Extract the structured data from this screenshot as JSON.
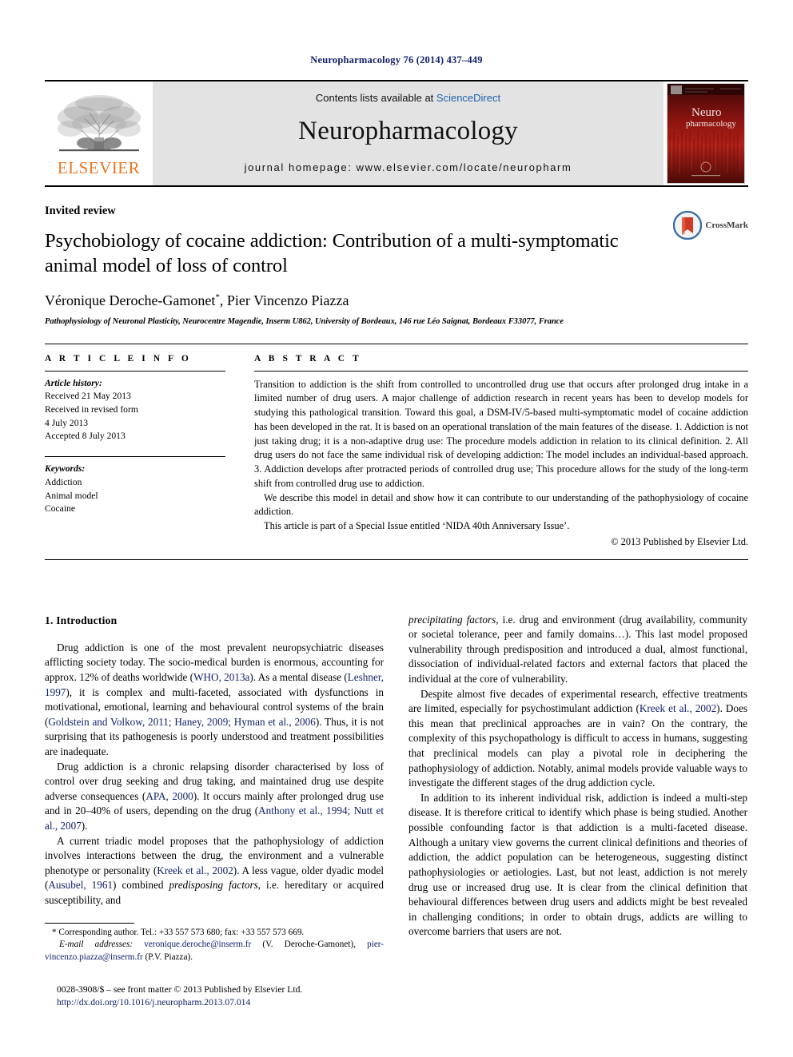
{
  "running_head": "Neuropharmacology 76 (2014) 437–449",
  "masthead": {
    "publisher_name": "ELSEVIER",
    "contents_prefix": "Contents lists available at ",
    "sciencedirect": "ScienceDirect",
    "journal_name": "Neuropharmacology",
    "homepage": "journal homepage: www.elsevier.com/locate/neuropharm",
    "cover": {
      "line1": "Neuro",
      "line2": "pharmacology",
      "accent_color": "#8e1410"
    },
    "link_color": "#2161b0"
  },
  "article": {
    "type": "Invited review",
    "title": "Psychobiology of cocaine addiction: Contribution of a multi-symptomatic animal model of loss of control",
    "authors": "Véronique Deroche-Gamonet*, Pier Vincenzo Piazza",
    "affiliation": "Pathophysiology of Neuronal Plasticity, Neurocentre Magendie, Inserm U862, University of Bordeaux, 146 rue Léo Saignat, Bordeaux F33077, France",
    "crossmark_label": "CrossMark"
  },
  "info": {
    "heading": "A R T I C L E  I N F O",
    "history_label": "Article history:",
    "history": [
      "Received 21 May 2013",
      "Received in revised form",
      "4 July 2013",
      "Accepted 8 July 2013"
    ],
    "keywords_label": "Keywords:",
    "keywords": [
      "Addiction",
      "Animal model",
      "Cocaine"
    ]
  },
  "abstract": {
    "heading": "A B S T R A C T",
    "paragraphs": [
      "Transition to addiction is the shift from controlled to uncontrolled drug use that occurs after prolonged drug intake in a limited number of drug users. A major challenge of addiction research in recent years has been to develop models for studying this pathological transition. Toward this goal, a DSM-IV/5-based multi-symptomatic model of cocaine addiction has been developed in the rat. It is based on an operational translation of the main features of the disease. 1. Addiction is not just taking drug; it is a non-adaptive drug use: The procedure models addiction in relation to its clinical definition. 2. All drug users do not face the same individual risk of developing addiction: The model includes an individual-based approach. 3. Addiction develops after protracted periods of controlled drug use; This procedure allows for the study of the long-term shift from controlled drug use to addiction.",
      "We describe this model in detail and show how it can contribute to our understanding of the pathophysiology of cocaine addiction.",
      "This article is part of a Special Issue entitled ‘NIDA 40th Anniversary Issue’."
    ],
    "copyright": "© 2013 Published by Elsevier Ltd."
  },
  "body": {
    "section_number_title": "1.  Introduction",
    "left_column": [
      {
        "id": "para-1",
        "indent": true,
        "runs": [
          {
            "t": "Drug addiction is one of the most prevalent neuropsychiatric diseases afflicting society today. The socio-medical burden is enormous, accounting for approx. 12% of deaths worldwide (",
            "s": "normal"
          },
          {
            "t": "WHO, 2013a",
            "s": "cite"
          },
          {
            "t": "). As a mental disease (",
            "s": "normal"
          },
          {
            "t": "Leshner, 1997",
            "s": "cite"
          },
          {
            "t": "), it is complex and multi-faceted, associated with dysfunctions in motivational, emotional, learning and behavioural control systems of the brain (",
            "s": "normal"
          },
          {
            "t": "Goldstein and Volkow, 2011; Haney, 2009; Hyman et al., 2006",
            "s": "cite"
          },
          {
            "t": "). Thus, it is not surprising that its pathogenesis is poorly understood and treatment possibilities are inadequate.",
            "s": "normal"
          }
        ]
      },
      {
        "id": "para-2",
        "indent": true,
        "runs": [
          {
            "t": "Drug addiction is a chronic relapsing disorder characterised by loss of control over drug seeking and drug taking, and maintained drug use despite adverse consequences (",
            "s": "normal"
          },
          {
            "t": "APA, 2000",
            "s": "cite"
          },
          {
            "t": "). It occurs mainly after prolonged drug use and in 20–40% of users, depending on the drug (",
            "s": "normal"
          },
          {
            "t": "Anthony et al., 1994; Nutt et al., 2007",
            "s": "cite"
          },
          {
            "t": ").",
            "s": "normal"
          }
        ]
      },
      {
        "id": "para-3",
        "indent": true,
        "runs": [
          {
            "t": "A current triadic model proposes that the pathophysiology of addiction involves interactions between the drug, the environment and a vulnerable phenotype or personality (",
            "s": "normal"
          },
          {
            "t": "Kreek et al., 2002",
            "s": "cite"
          },
          {
            "t": "). A less vague, older dyadic model (",
            "s": "normal"
          },
          {
            "t": "Ausubel, 1961",
            "s": "cite"
          },
          {
            "t": ") combined ",
            "s": "normal"
          },
          {
            "t": "predisposing factors",
            "s": "italic"
          },
          {
            "t": ", i.e. hereditary or acquired susceptibility, and",
            "s": "normal"
          }
        ]
      }
    ],
    "right_column": [
      {
        "id": "para-4",
        "indent": false,
        "runs": [
          {
            "t": "precipitating factors",
            "s": "italic"
          },
          {
            "t": ", i.e. drug and environment (drug availability, community or societal tolerance, peer and family domains…). This last model proposed vulnerability through predisposition and introduced a dual, almost functional, dissociation of individual-related factors and external factors that placed the individual at the core of vulnerability.",
            "s": "normal"
          }
        ]
      },
      {
        "id": "para-5",
        "indent": true,
        "runs": [
          {
            "t": "Despite almost five decades of experimental research, effective treatments are limited, especially for psychostimulant addiction (",
            "s": "normal"
          },
          {
            "t": "Kreek et al., 2002",
            "s": "cite"
          },
          {
            "t": "). Does this mean that preclinical approaches are in vain? On the contrary, the complexity of this psychopathology is difficult to access in humans, suggesting that preclinical models can play a pivotal role in deciphering the pathophysiology of addiction. Notably, animal models provide valuable ways to investigate the different stages of the drug addiction cycle.",
            "s": "normal"
          }
        ]
      },
      {
        "id": "para-6",
        "indent": true,
        "runs": [
          {
            "t": "In addition to its inherent individual risk, addiction is indeed a multi-step disease. It is therefore critical to identify which phase is being studied. Another possible confounding factor is that addiction is a multi-faceted disease. Although a unitary view governs the current clinical definitions and theories of addiction, the addict population can be heterogeneous, suggesting distinct pathophysiologies or aetiologies. Last, but not least, addiction is not merely drug use or increased drug use. It is clear from the clinical definition that behavioural differences between drug users and addicts might be best revealed in challenging conditions; in order to obtain drugs, addicts are willing to overcome barriers that users are not.",
            "s": "normal"
          }
        ]
      }
    ]
  },
  "footnotes": {
    "corresponding": "* Corresponding author. Tel.: +33 557 573 680; fax: +33 557 573 669.",
    "email_label": "E-mail addresses:",
    "email1": "veronique.deroche@inserm.fr",
    "email1_name": "(V. Deroche-Gamonet),",
    "email2": "pier-vincenzo.piazza@inserm.fr",
    "email2_name": "(P.V. Piazza).",
    "issn_line": "0028-3908/$ – see front matter © 2013 Published by Elsevier Ltd.",
    "doi": "http://dx.doi.org/10.1016/j.neuropharm.2013.07.014"
  }
}
